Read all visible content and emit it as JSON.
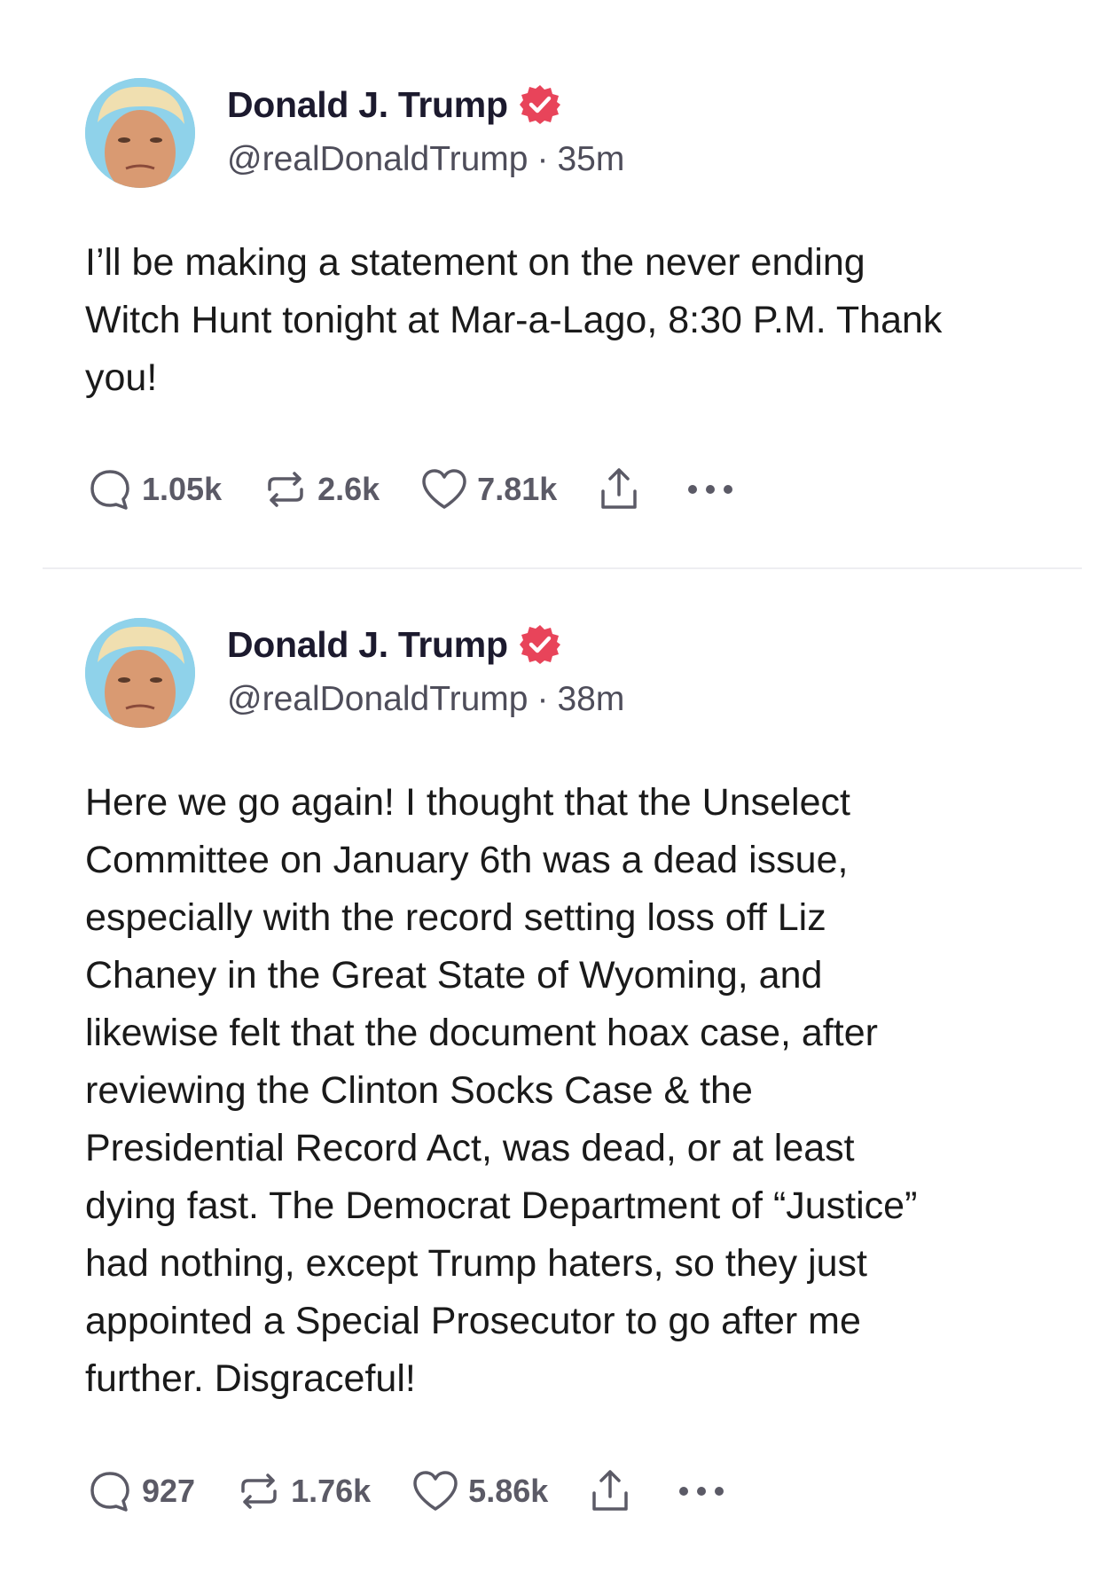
{
  "posts": [
    {
      "author": {
        "display_name": "Donald J. Trump",
        "handle": "@realDonaldTrump",
        "verified": true
      },
      "separator": "·",
      "time": "35m",
      "lines": [
        "I’ll be making a statement on the never ending",
        "Witch Hunt tonight at Mar-a-Lago, 8:30 P.M. Thank",
        "you!"
      ],
      "stats": {
        "replies": "1.05k",
        "reposts": "2.6k",
        "likes": "7.81k"
      }
    },
    {
      "author": {
        "display_name": "Donald J. Trump",
        "handle": "@realDonaldTrump",
        "verified": true
      },
      "separator": "·",
      "time": "38m",
      "lines": [
        "Here we go again! I thought that the Unselect",
        "Committee on January 6th was a dead issue,",
        "especially with the record setting loss off Liz",
        "Chaney in the Great State of Wyoming, and",
        "likewise felt that the document hoax case, after",
        "reviewing the Clinton Socks Case & the",
        "Presidential Record Act, was dead, or at least",
        "dying fast. The Democrat Department of “Justice”",
        "had nothing, except Trump haters, so they just",
        "appointed a Special Prosecutor to go after me",
        "further. Disgraceful!"
      ],
      "stats": {
        "replies": "927",
        "reposts": "1.76k",
        "likes": "5.86k"
      }
    }
  ],
  "colors": {
    "verified_badge": "#e8445a",
    "icon_gray": "#5b5a66",
    "divider": "#eeeef1",
    "avatar_bg": "#8fd2ea"
  },
  "icons": {
    "reply": "speech-bubble-icon",
    "repost": "repost-arrows-icon",
    "like": "heart-icon",
    "share": "share-upload-icon",
    "more": "ellipsis-icon",
    "verified": "verified-badge-icon"
  }
}
